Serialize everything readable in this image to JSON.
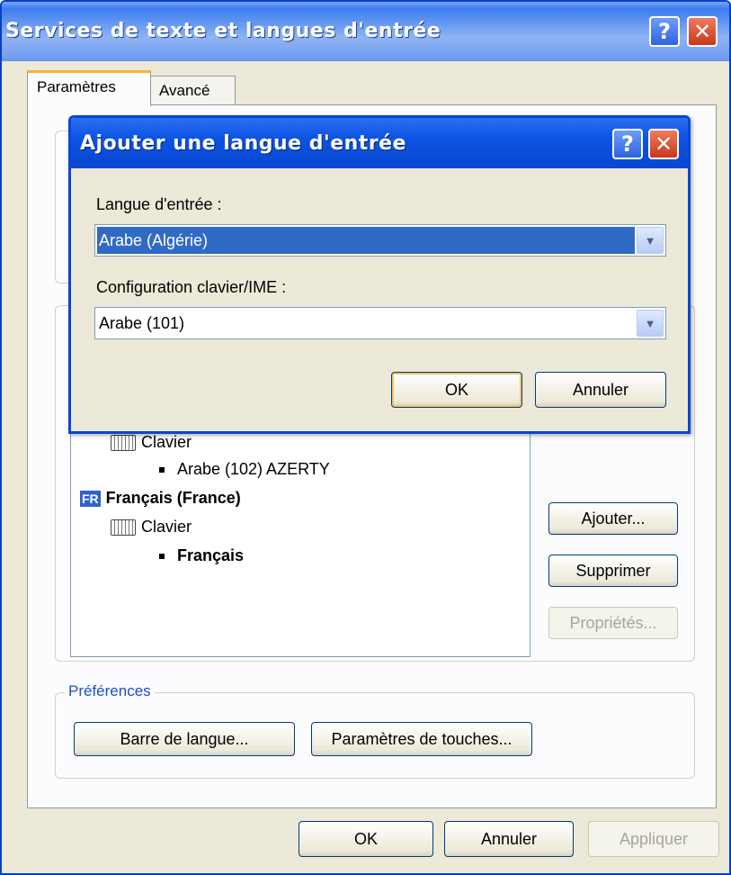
{
  "window": {
    "title": "Services de texte et langues d'entrée",
    "help": "?",
    "close": "✕"
  },
  "tabs": [
    {
      "label": "Paramètres",
      "active": true
    },
    {
      "label": "Avancé",
      "active": false
    }
  ],
  "installed_list": {
    "rows": [
      {
        "kind": "kbd",
        "text": "Clavier"
      },
      {
        "kind": "layout",
        "text": "Arabe (102) AZERTY"
      },
      {
        "kind": "lang",
        "badge": "FR",
        "text": "Français (France)"
      },
      {
        "kind": "kbd",
        "text": "Clavier"
      },
      {
        "kind": "layout-bold",
        "text": "Français"
      }
    ]
  },
  "side_buttons": {
    "add": "Ajouter...",
    "remove": "Supprimer",
    "props": "Propriétés..."
  },
  "preferences": {
    "label": "Préférences",
    "langbar": "Barre de langue...",
    "keys": "Paramètres de touches..."
  },
  "footer": {
    "ok": "OK",
    "cancel": "Annuler",
    "apply": "Appliquer"
  },
  "dialog": {
    "title": "Ajouter une langue d'entrée",
    "help": "?",
    "close": "✕",
    "input_lang_label": "Langue d'entrée :",
    "input_lang_value": "Arabe (Algérie)",
    "layout_label": "Configuration clavier/IME :",
    "layout_value": "Arabe (101)",
    "ok": "OK",
    "cancel": "Annuler"
  },
  "icons": {
    "dropdown": "chevron-down-icon",
    "keyboard": "keyboard-icon"
  },
  "colors": {
    "titlebar": "#3c7df0",
    "dialog_titlebar": "#0c54e3",
    "selection": "#316ac5",
    "close": "#c8381b"
  }
}
